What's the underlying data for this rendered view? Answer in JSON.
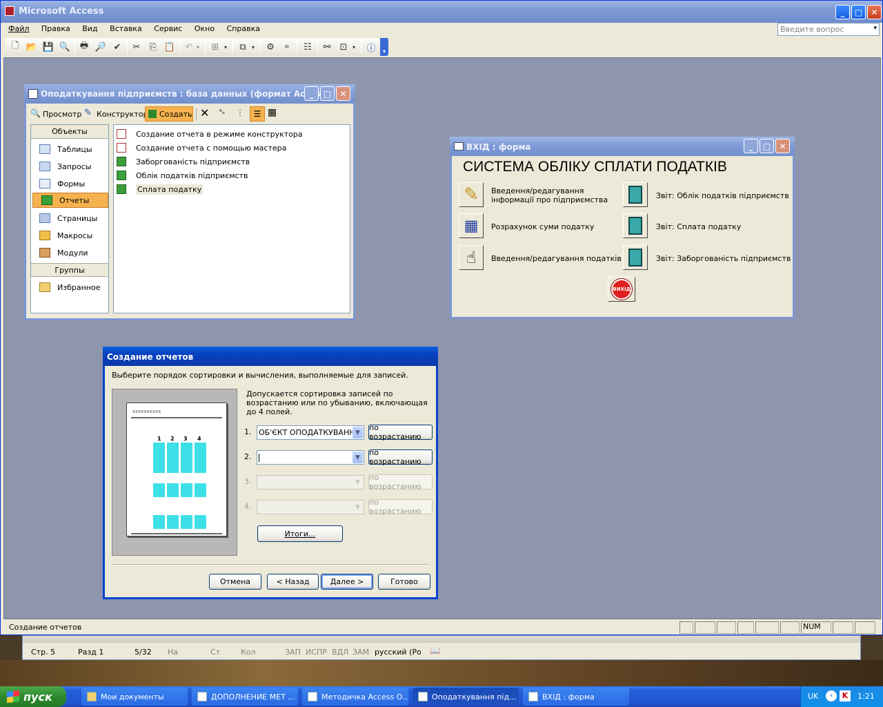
{
  "app": {
    "title": "Microsoft Access"
  },
  "menu": [
    "Файл",
    "Правка",
    "Вид",
    "Вставка",
    "Сервис",
    "Окно",
    "Справка"
  ],
  "help_search": {
    "placeholder": "Введите вопрос"
  },
  "db_window": {
    "title": "Оподаткування підприємств : база данных (формат Access...",
    "toolbar": {
      "view": "Просмотр",
      "design": "Конструктор",
      "create": "Создать"
    },
    "objects_header": "Объекты",
    "objects": [
      "Таблицы",
      "Запросы",
      "Формы",
      "Отчеты",
      "Страницы",
      "Макросы",
      "Модули"
    ],
    "selected_object": "Отчеты",
    "groups_header": "Группы",
    "groups": [
      "Избранное"
    ],
    "items": [
      "Создание отчета в режиме конструктора",
      "Создание отчета с помощью мастера",
      "Заборгованість підприємств",
      "Облік податків підприємств",
      "Сплата податку"
    ]
  },
  "form_window": {
    "title": "ВХІД : форма",
    "heading": "СИСТЕМА ОБЛІКУ СПЛАТИ ПОДАТКІВ",
    "left_buttons": [
      "Введення/редагування інформації про підприємства",
      "Розрахунок суми податку",
      "Введення/редагування податків"
    ],
    "right_buttons": [
      "Звіт: Облік податків підприємств",
      "Звіт: Сплата податку",
      "Звіт: Заборгованість підприємств"
    ],
    "exit_label": "ВИХІД"
  },
  "wizard": {
    "title": "Создание отчетов",
    "instruction": "Выберите порядок сортировки и вычисления, выполняемые для записей.",
    "hint": "Допускается сортировка записей по возрастанию или по убыванию, включающая до 4 полей.",
    "preview_text": "xxxxxxxxxx",
    "preview_cols": [
      "1",
      "2",
      "3",
      "4"
    ],
    "rows": [
      {
        "num": "1.",
        "value": "ОБ'ЄКТ ОПОДАТКУВАННЯ",
        "order": "по возрастанию"
      },
      {
        "num": "2.",
        "value": "",
        "order": "по возрастанию"
      },
      {
        "num": "3.",
        "value": "",
        "order": "по возрастанию"
      },
      {
        "num": "4.",
        "value": "",
        "order": "по возрастанию"
      }
    ],
    "summary_btn": "Итоги...",
    "cancel": "Отмена",
    "back": "< Назад",
    "next": "Далее >",
    "finish": "Готово"
  },
  "statusbar": {
    "text": "Создание отчетов",
    "num": "NUM"
  },
  "word_status": {
    "page": "Стр. 5",
    "section": "Разд 1",
    "pages": "5/32",
    "at": "На",
    "line": "Ст",
    "col": "Кол",
    "rec": "ЗАП",
    "trk": "ИСПР",
    "ext": "ВДЛ",
    "ovr": "ЗАМ",
    "lang": "русский (Ро"
  },
  "taskbar": {
    "start": "пуск",
    "tasks": [
      "Мои документы",
      "ДОПОЛНЕНИЕ МЕТ ...",
      "Методичка Access О...",
      "Оподаткування під...",
      "ВХІД : форма"
    ],
    "lang": "UK",
    "clock": "1:21"
  },
  "colors": {
    "mdi_bg": "#8e96ad",
    "highlight": "#f6b24e",
    "form_bg": "#ece9d8"
  }
}
